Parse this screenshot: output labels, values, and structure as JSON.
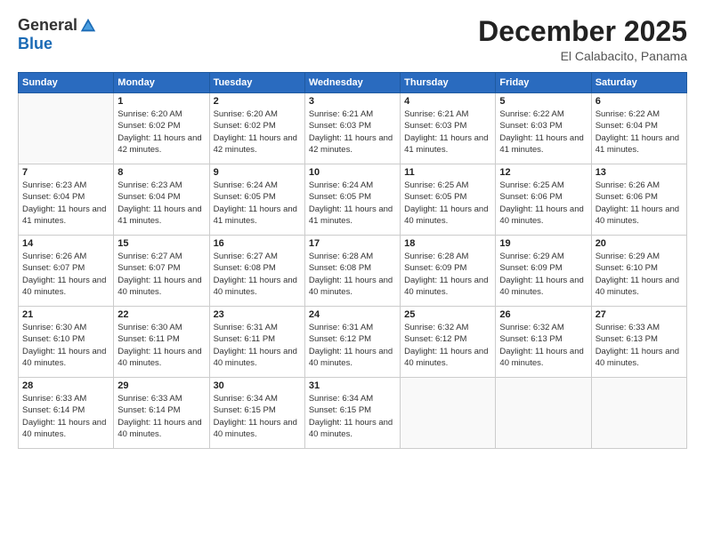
{
  "logo": {
    "general": "General",
    "blue": "Blue"
  },
  "title": "December 2025",
  "subtitle": "El Calabacito, Panama",
  "headers": [
    "Sunday",
    "Monday",
    "Tuesday",
    "Wednesday",
    "Thursday",
    "Friday",
    "Saturday"
  ],
  "weeks": [
    [
      {
        "day": "",
        "sunrise": "",
        "sunset": "",
        "daylight": ""
      },
      {
        "day": "1",
        "sunrise": "Sunrise: 6:20 AM",
        "sunset": "Sunset: 6:02 PM",
        "daylight": "Daylight: 11 hours and 42 minutes."
      },
      {
        "day": "2",
        "sunrise": "Sunrise: 6:20 AM",
        "sunset": "Sunset: 6:02 PM",
        "daylight": "Daylight: 11 hours and 42 minutes."
      },
      {
        "day": "3",
        "sunrise": "Sunrise: 6:21 AM",
        "sunset": "Sunset: 6:03 PM",
        "daylight": "Daylight: 11 hours and 42 minutes."
      },
      {
        "day": "4",
        "sunrise": "Sunrise: 6:21 AM",
        "sunset": "Sunset: 6:03 PM",
        "daylight": "Daylight: 11 hours and 41 minutes."
      },
      {
        "day": "5",
        "sunrise": "Sunrise: 6:22 AM",
        "sunset": "Sunset: 6:03 PM",
        "daylight": "Daylight: 11 hours and 41 minutes."
      },
      {
        "day": "6",
        "sunrise": "Sunrise: 6:22 AM",
        "sunset": "Sunset: 6:04 PM",
        "daylight": "Daylight: 11 hours and 41 minutes."
      }
    ],
    [
      {
        "day": "7",
        "sunrise": "Sunrise: 6:23 AM",
        "sunset": "Sunset: 6:04 PM",
        "daylight": "Daylight: 11 hours and 41 minutes."
      },
      {
        "day": "8",
        "sunrise": "Sunrise: 6:23 AM",
        "sunset": "Sunset: 6:04 PM",
        "daylight": "Daylight: 11 hours and 41 minutes."
      },
      {
        "day": "9",
        "sunrise": "Sunrise: 6:24 AM",
        "sunset": "Sunset: 6:05 PM",
        "daylight": "Daylight: 11 hours and 41 minutes."
      },
      {
        "day": "10",
        "sunrise": "Sunrise: 6:24 AM",
        "sunset": "Sunset: 6:05 PM",
        "daylight": "Daylight: 11 hours and 41 minutes."
      },
      {
        "day": "11",
        "sunrise": "Sunrise: 6:25 AM",
        "sunset": "Sunset: 6:05 PM",
        "daylight": "Daylight: 11 hours and 40 minutes."
      },
      {
        "day": "12",
        "sunrise": "Sunrise: 6:25 AM",
        "sunset": "Sunset: 6:06 PM",
        "daylight": "Daylight: 11 hours and 40 minutes."
      },
      {
        "day": "13",
        "sunrise": "Sunrise: 6:26 AM",
        "sunset": "Sunset: 6:06 PM",
        "daylight": "Daylight: 11 hours and 40 minutes."
      }
    ],
    [
      {
        "day": "14",
        "sunrise": "Sunrise: 6:26 AM",
        "sunset": "Sunset: 6:07 PM",
        "daylight": "Daylight: 11 hours and 40 minutes."
      },
      {
        "day": "15",
        "sunrise": "Sunrise: 6:27 AM",
        "sunset": "Sunset: 6:07 PM",
        "daylight": "Daylight: 11 hours and 40 minutes."
      },
      {
        "day": "16",
        "sunrise": "Sunrise: 6:27 AM",
        "sunset": "Sunset: 6:08 PM",
        "daylight": "Daylight: 11 hours and 40 minutes."
      },
      {
        "day": "17",
        "sunrise": "Sunrise: 6:28 AM",
        "sunset": "Sunset: 6:08 PM",
        "daylight": "Daylight: 11 hours and 40 minutes."
      },
      {
        "day": "18",
        "sunrise": "Sunrise: 6:28 AM",
        "sunset": "Sunset: 6:09 PM",
        "daylight": "Daylight: 11 hours and 40 minutes."
      },
      {
        "day": "19",
        "sunrise": "Sunrise: 6:29 AM",
        "sunset": "Sunset: 6:09 PM",
        "daylight": "Daylight: 11 hours and 40 minutes."
      },
      {
        "day": "20",
        "sunrise": "Sunrise: 6:29 AM",
        "sunset": "Sunset: 6:10 PM",
        "daylight": "Daylight: 11 hours and 40 minutes."
      }
    ],
    [
      {
        "day": "21",
        "sunrise": "Sunrise: 6:30 AM",
        "sunset": "Sunset: 6:10 PM",
        "daylight": "Daylight: 11 hours and 40 minutes."
      },
      {
        "day": "22",
        "sunrise": "Sunrise: 6:30 AM",
        "sunset": "Sunset: 6:11 PM",
        "daylight": "Daylight: 11 hours and 40 minutes."
      },
      {
        "day": "23",
        "sunrise": "Sunrise: 6:31 AM",
        "sunset": "Sunset: 6:11 PM",
        "daylight": "Daylight: 11 hours and 40 minutes."
      },
      {
        "day": "24",
        "sunrise": "Sunrise: 6:31 AM",
        "sunset": "Sunset: 6:12 PM",
        "daylight": "Daylight: 11 hours and 40 minutes."
      },
      {
        "day": "25",
        "sunrise": "Sunrise: 6:32 AM",
        "sunset": "Sunset: 6:12 PM",
        "daylight": "Daylight: 11 hours and 40 minutes."
      },
      {
        "day": "26",
        "sunrise": "Sunrise: 6:32 AM",
        "sunset": "Sunset: 6:13 PM",
        "daylight": "Daylight: 11 hours and 40 minutes."
      },
      {
        "day": "27",
        "sunrise": "Sunrise: 6:33 AM",
        "sunset": "Sunset: 6:13 PM",
        "daylight": "Daylight: 11 hours and 40 minutes."
      }
    ],
    [
      {
        "day": "28",
        "sunrise": "Sunrise: 6:33 AM",
        "sunset": "Sunset: 6:14 PM",
        "daylight": "Daylight: 11 hours and 40 minutes."
      },
      {
        "day": "29",
        "sunrise": "Sunrise: 6:33 AM",
        "sunset": "Sunset: 6:14 PM",
        "daylight": "Daylight: 11 hours and 40 minutes."
      },
      {
        "day": "30",
        "sunrise": "Sunrise: 6:34 AM",
        "sunset": "Sunset: 6:15 PM",
        "daylight": "Daylight: 11 hours and 40 minutes."
      },
      {
        "day": "31",
        "sunrise": "Sunrise: 6:34 AM",
        "sunset": "Sunset: 6:15 PM",
        "daylight": "Daylight: 11 hours and 40 minutes."
      },
      {
        "day": "",
        "sunrise": "",
        "sunset": "",
        "daylight": ""
      },
      {
        "day": "",
        "sunrise": "",
        "sunset": "",
        "daylight": ""
      },
      {
        "day": "",
        "sunrise": "",
        "sunset": "",
        "daylight": ""
      }
    ]
  ]
}
